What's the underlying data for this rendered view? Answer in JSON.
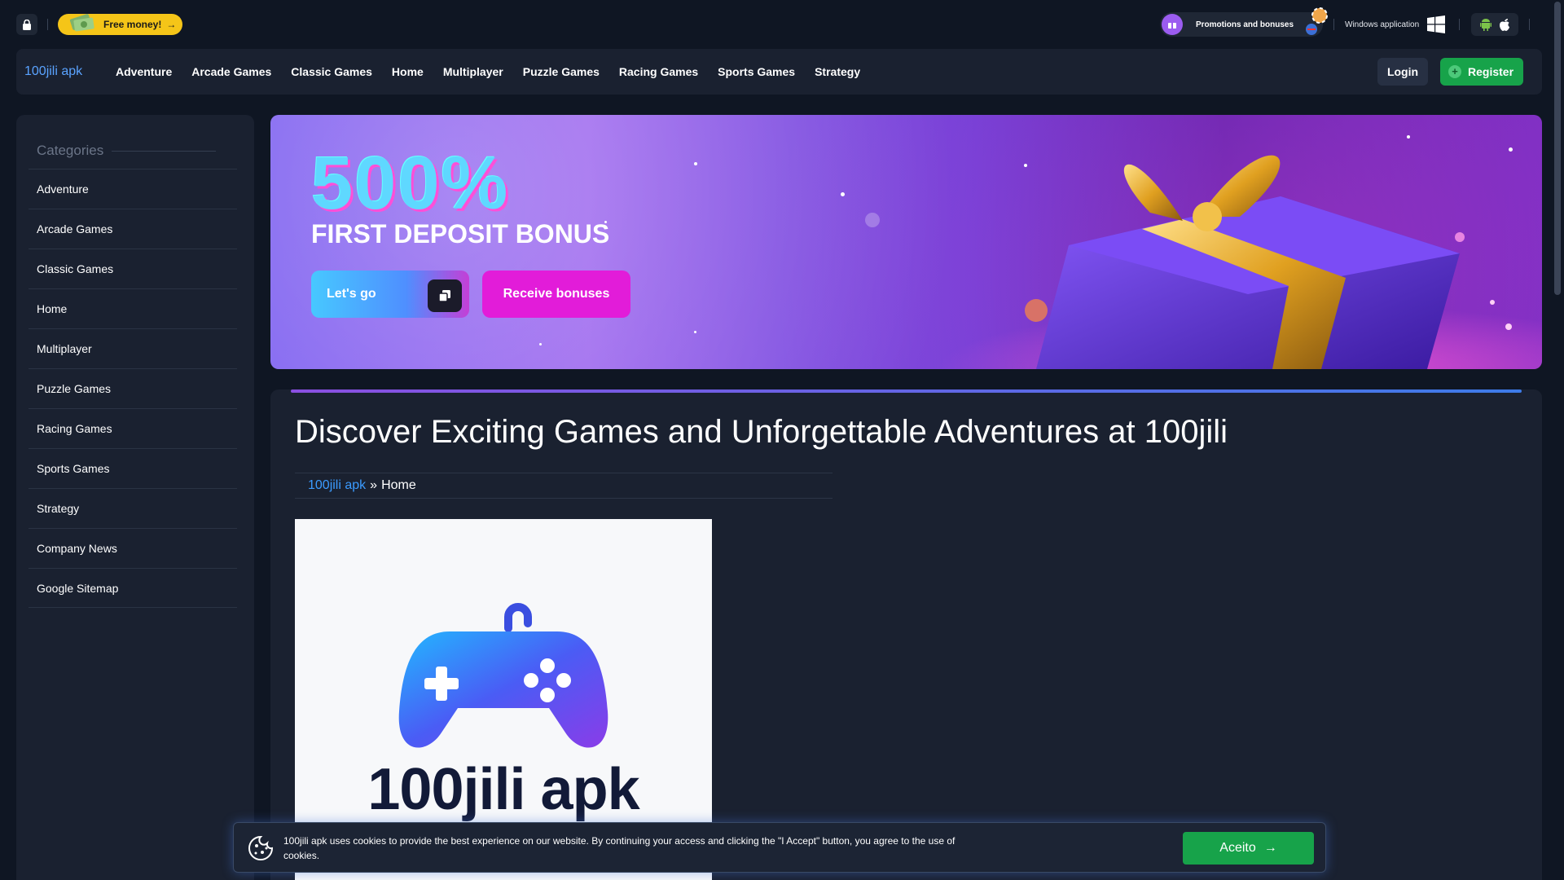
{
  "topbar": {
    "free_money": "Free money!",
    "promotions": "Promotions and bonuses",
    "windows_app": "Windows application"
  },
  "nav": {
    "logo_alt": "100jili apk",
    "items": [
      "Adventure",
      "Arcade Games",
      "Classic Games",
      "Home",
      "Multiplayer",
      "Puzzle Games",
      "Racing Games",
      "Sports Games",
      "Strategy"
    ],
    "login": "Login",
    "register": "Register"
  },
  "sidebar": {
    "title": "Categories",
    "items": [
      "Adventure",
      "Arcade Games",
      "Classic Games",
      "Home",
      "Multiplayer",
      "Puzzle Games",
      "Racing Games",
      "Sports Games",
      "Strategy",
      "Company News",
      "Google Sitemap"
    ]
  },
  "banner": {
    "percent": "500%",
    "subtitle": "FIRST DEPOSIT BONUS",
    "lets_go": "Let's go",
    "receive": "Receive bonuses"
  },
  "content": {
    "title": "Discover Exciting Games and Unforgettable Adventures at 100jili",
    "breadcrumb_link": "100jili apk",
    "breadcrumb_sep": "»",
    "breadcrumb_current": "Home",
    "image_text": "100jili apk"
  },
  "cookie": {
    "text": "100jili apk uses cookies to provide the best experience on our website. By continuing your access and clicking the \"I Accept\" button, you agree to the use of cookies.",
    "accept": "Aceito"
  },
  "colors": {
    "background": "#0f1623",
    "panel": "#1a2130",
    "accent_green": "#17a34a",
    "accent_yellow": "#f5c518",
    "link_blue": "#3b9bff"
  }
}
